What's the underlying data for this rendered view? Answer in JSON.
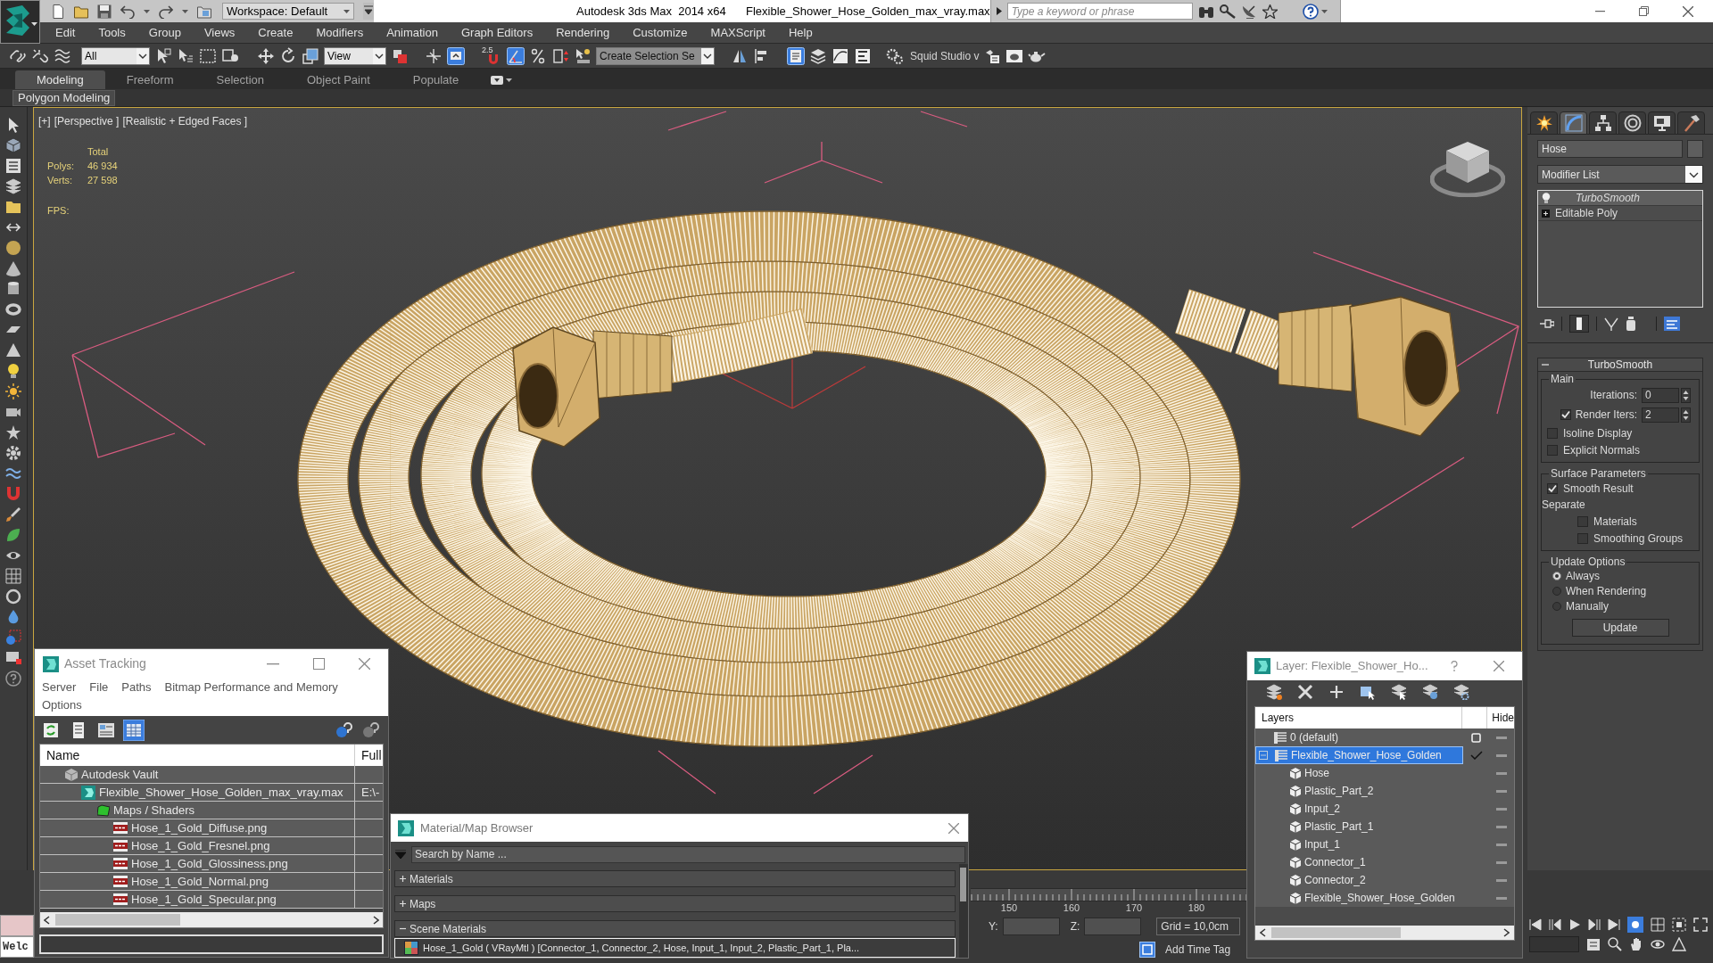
{
  "title_bar": {
    "workspace": "Workspace: Default",
    "app_title": "Autodesk 3ds Max  2014 x64",
    "file_name": "Flexible_Shower_Hose_Golden_max_vray.max",
    "search": {
      "placeholder": "Type a keyword or phrase"
    }
  },
  "menu_bar": [
    "Edit",
    "Tools",
    "Group",
    "Views",
    "Create",
    "Modifiers",
    "Animation",
    "Graph Editors",
    "Rendering",
    "Customize",
    "MAXScript",
    "Help"
  ],
  "main_toolbar": {
    "selection_filter": "All",
    "reference_coordinate_system": "View",
    "keyboard_override": {
      "on": true
    },
    "snaps": [
      {
        "kind": "snap",
        "label": "2.5",
        "on": false
      },
      {
        "kind": "angle",
        "on": true
      },
      {
        "kind": "percent",
        "on": false
      },
      {
        "kind": "spinner",
        "on": false
      }
    ],
    "named_selection_set": "Create Selection Se",
    "scene_explorer": {
      "on": true
    },
    "workspace_label": "Squid Studio v"
  },
  "ribbon": {
    "tabs": [
      {
        "label": "Modeling",
        "selected": true
      },
      {
        "label": "Freeform",
        "selected": false
      },
      {
        "label": "Selection",
        "selected": false
      },
      {
        "label": "Object Paint",
        "selected": false
      },
      {
        "label": "Populate",
        "selected": false
      }
    ],
    "panel": "Polygon Modeling"
  },
  "viewport": {
    "active": true,
    "labels": [
      "[+]",
      "[Perspective ]",
      "[Realistic + Edged Faces ]"
    ],
    "stats": {
      "heading": "Total",
      "rows": [
        {
          "label": "Polys:",
          "value": "46 934"
        },
        {
          "label": "Verts:",
          "value": "27 598"
        }
      ],
      "fps_label": "FPS:"
    }
  },
  "command_panel": {
    "tabs": [
      {
        "kind": "create",
        "selected": false
      },
      {
        "kind": "modify",
        "selected": true
      },
      {
        "kind": "hierarchy",
        "selected": false
      },
      {
        "kind": "motion",
        "selected": false
      },
      {
        "kind": "display",
        "selected": false
      },
      {
        "kind": "utilities",
        "selected": false
      }
    ],
    "object_name": "Hose",
    "modifier_list": "Modifier List",
    "stack": [
      {
        "label": "TurboSmooth",
        "kind": "modifier",
        "selected": true
      },
      {
        "label": "Editable Poly",
        "kind": "base_object",
        "selected": false
      }
    ],
    "rollout": {
      "title": "TurboSmooth",
      "expanded": true,
      "groups": [
        {
          "title": "Main",
          "controls": [
            {
              "kind": "spinner",
              "label": "Iterations:",
              "value": "0"
            },
            {
              "kind": "spinner",
              "label": "Render Iters:",
              "value": "2",
              "checked": true
            },
            {
              "kind": "checkbox",
              "label": "Isoline Display",
              "checked": false
            },
            {
              "kind": "checkbox",
              "label": "Explicit Normals",
              "checked": false
            }
          ]
        },
        {
          "title": "Surface Parameters",
          "controls": [
            {
              "kind": "checkbox",
              "label": "Smooth Result",
              "checked": true
            },
            {
              "kind": "label",
              "label": "Separate",
              "children": [
                {
                  "kind": "checkbox",
                  "label": "Materials",
                  "checked": false
                },
                {
                  "kind": "checkbox",
                  "label": "Smoothing Groups",
                  "checked": false
                }
              ]
            }
          ]
        },
        {
          "title": "Update Options",
          "controls": [
            {
              "kind": "radio",
              "label": "Always",
              "selected": true
            },
            {
              "kind": "radio",
              "label": "When Rendering",
              "selected": false
            },
            {
              "kind": "radio",
              "label": "Manually",
              "selected": false
            },
            {
              "kind": "button",
              "label": "Update"
            }
          ]
        }
      ]
    }
  },
  "asset_tracking": {
    "title": "Asset Tracking",
    "menu": [
      "Server",
      "File",
      "Paths",
      "Bitmap Performance and Memory",
      "Options"
    ],
    "toolbar": [
      {
        "kind": "refresh",
        "selected": false
      },
      {
        "kind": "list",
        "selected": false
      },
      {
        "kind": "thumbnails",
        "selected": false
      },
      {
        "kind": "table",
        "selected": true
      }
    ],
    "columns": [
      "Name",
      "Full"
    ],
    "tree": [
      {
        "name": "Autodesk Vault",
        "kind": "vault",
        "children": [
          {
            "name": "Flexible_Shower_Hose_Golden_max_vray.max",
            "kind": "scene",
            "full": "E:\\-",
            "children": [
              {
                "name": "Maps / Shaders",
                "kind": "folder",
                "children": [
                  {
                    "name": "Hose_1_Gold_Diffuse.png",
                    "kind": "image"
                  },
                  {
                    "name": "Hose_1_Gold_Fresnel.png",
                    "kind": "image"
                  },
                  {
                    "name": "Hose_1_Gold_Glossiness.png",
                    "kind": "image"
                  },
                  {
                    "name": "Hose_1_Gold_Normal.png",
                    "kind": "image"
                  },
                  {
                    "name": "Hose_1_Gold_Specular.png",
                    "kind": "image"
                  }
                ]
              }
            ]
          }
        ]
      }
    ]
  },
  "material_browser": {
    "title": "Material/Map Browser",
    "search": {
      "placeholder": "Search by Name ..."
    },
    "groups": [
      {
        "label": "Materials",
        "expanded": false
      },
      {
        "label": "Maps",
        "expanded": false
      },
      {
        "label": "Scene Materials",
        "expanded": true,
        "items": [
          {
            "label": "Hose_1_Gold ( VRayMtl ) [Connector_1, Connector_2, Hose, Input_1, Input_2, Plastic_Part_1, Pla...",
            "selected": true
          }
        ]
      }
    ]
  },
  "layer_manager": {
    "title": "Layer: Flexible_Shower_Ho...",
    "columns": [
      "Layers",
      "Hide"
    ],
    "tree": [
      {
        "name": "0 (default)",
        "kind": "layer",
        "selected": false,
        "current": false,
        "hidden": false
      },
      {
        "name": "Flexible_Shower_Hose_Golden",
        "kind": "layer",
        "selected": true,
        "current": true,
        "expanded": true,
        "hidden": false,
        "children": [
          {
            "name": "Hose",
            "kind": "object",
            "selected": false,
            "hidden": false
          },
          {
            "name": "Plastic_Part_2",
            "kind": "object",
            "selected": false,
            "hidden": false
          },
          {
            "name": "Input_2",
            "kind": "object",
            "selected": false,
            "hidden": false
          },
          {
            "name": "Plastic_Part_1",
            "kind": "object",
            "selected": false,
            "hidden": false
          },
          {
            "name": "Input_1",
            "kind": "object",
            "selected": false,
            "hidden": false
          },
          {
            "name": "Connector_1",
            "kind": "object",
            "selected": false,
            "hidden": false
          },
          {
            "name": "Connector_2",
            "kind": "object",
            "selected": false,
            "hidden": false
          },
          {
            "name": "Flexible_Shower_Hose_Golden",
            "kind": "object",
            "selected": false,
            "hidden": false
          }
        ]
      }
    ]
  },
  "script_listener": {
    "output": "Welc"
  },
  "time_ruler": {
    "labels": [
      "150",
      "160",
      "170",
      "180"
    ]
  },
  "status_bar": {
    "coordinate_labels": [
      "Y:",
      "Z:"
    ],
    "grid": "Grid = 10,0cm",
    "time_tag": "Add Time Tag"
  }
}
